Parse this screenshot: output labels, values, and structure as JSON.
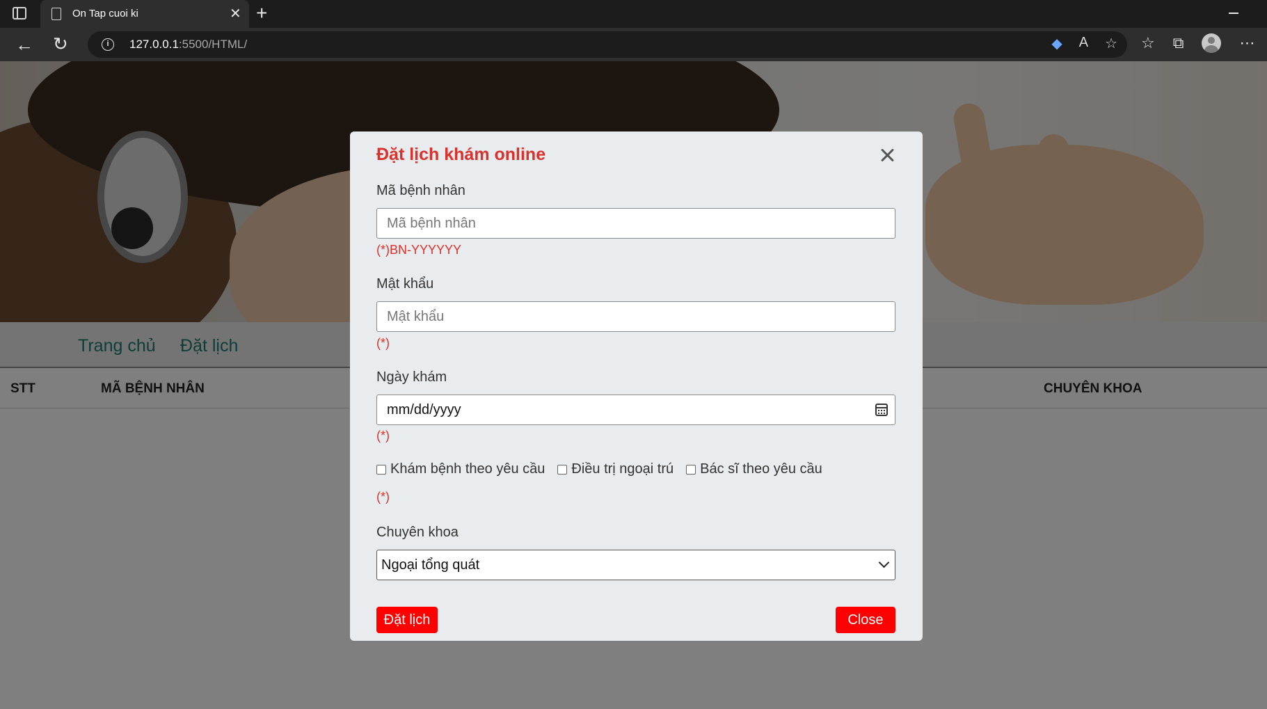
{
  "browser": {
    "tab_title": "On Tap cuoi ki",
    "url_host": "127.0.0.1",
    "url_rest": ":5500/HTML/"
  },
  "page": {
    "menu": [
      "Trang chủ",
      "Đặt lịch"
    ],
    "table_headers": [
      "STT",
      "MÃ BỆNH NHÂN",
      "CHUYÊN KHOA"
    ]
  },
  "modal": {
    "title": "Đặt lịch khám online",
    "patient_id": {
      "label": "Mã bệnh nhân",
      "placeholder": "Mã bệnh nhân",
      "value": "",
      "hint": "(*)BN-YYYYYY"
    },
    "password": {
      "label": "Mật khẩu",
      "placeholder": "Mật khẩu",
      "value": "",
      "hint": "(*)"
    },
    "date": {
      "label": "Ngày khám",
      "placeholder": "mm/dd/yyyy",
      "hint": "(*)"
    },
    "services": {
      "options": [
        {
          "label": "Khám bệnh theo yêu cầu",
          "checked": false
        },
        {
          "label": "Điều trị ngoại trú",
          "checked": false
        },
        {
          "label": "Bác sĩ theo yêu cầu",
          "checked": false
        }
      ],
      "hint": "(*)"
    },
    "department": {
      "label": "Chuyên khoa",
      "selected": "Ngoại tổng quát"
    },
    "submit_label": "Đặt lịch",
    "close_label": "Close"
  },
  "colors": {
    "title_red": "#d9322c",
    "button_red": "#ff0000",
    "menu_link": "#1f7a6e"
  }
}
